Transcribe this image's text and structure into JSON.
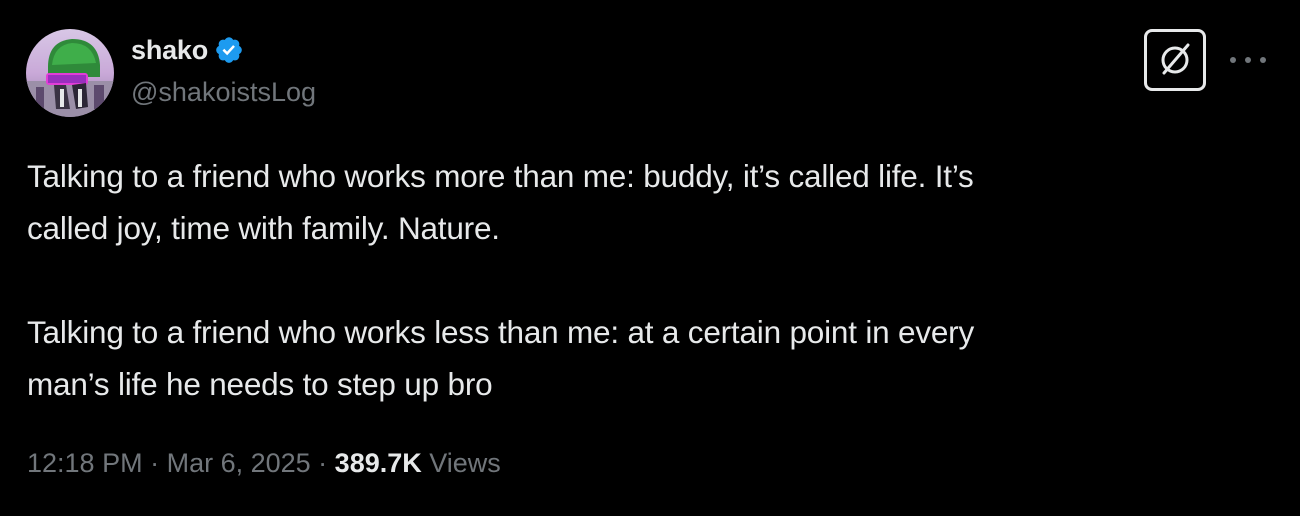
{
  "tweet": {
    "author": {
      "display_name": "shako",
      "handle": "@shakoistsLog",
      "verified": true,
      "avatar_icon": "avatar-image"
    },
    "grok_button_icon": "slashed-circle-icon",
    "more_button_icon": "more-dots-icon",
    "paragraphs": [
      [
        "Talking to a friend who works more than me: buddy, it’s called life. It’s",
        "called joy, time with family. Nature."
      ],
      [
        "Talking to a friend who works less than me: at a certain point in every",
        "man’s life he needs to step up bro"
      ]
    ],
    "meta": {
      "time": "12:18 PM",
      "separator": " · ",
      "date": "Mar 6, 2025",
      "views_count": "389.7K",
      "views_label": "Views"
    }
  },
  "colors": {
    "background": "#000000",
    "text_primary": "#e7e9ea",
    "text_secondary": "#71767b",
    "verified_blue": "#1d9bf0"
  }
}
